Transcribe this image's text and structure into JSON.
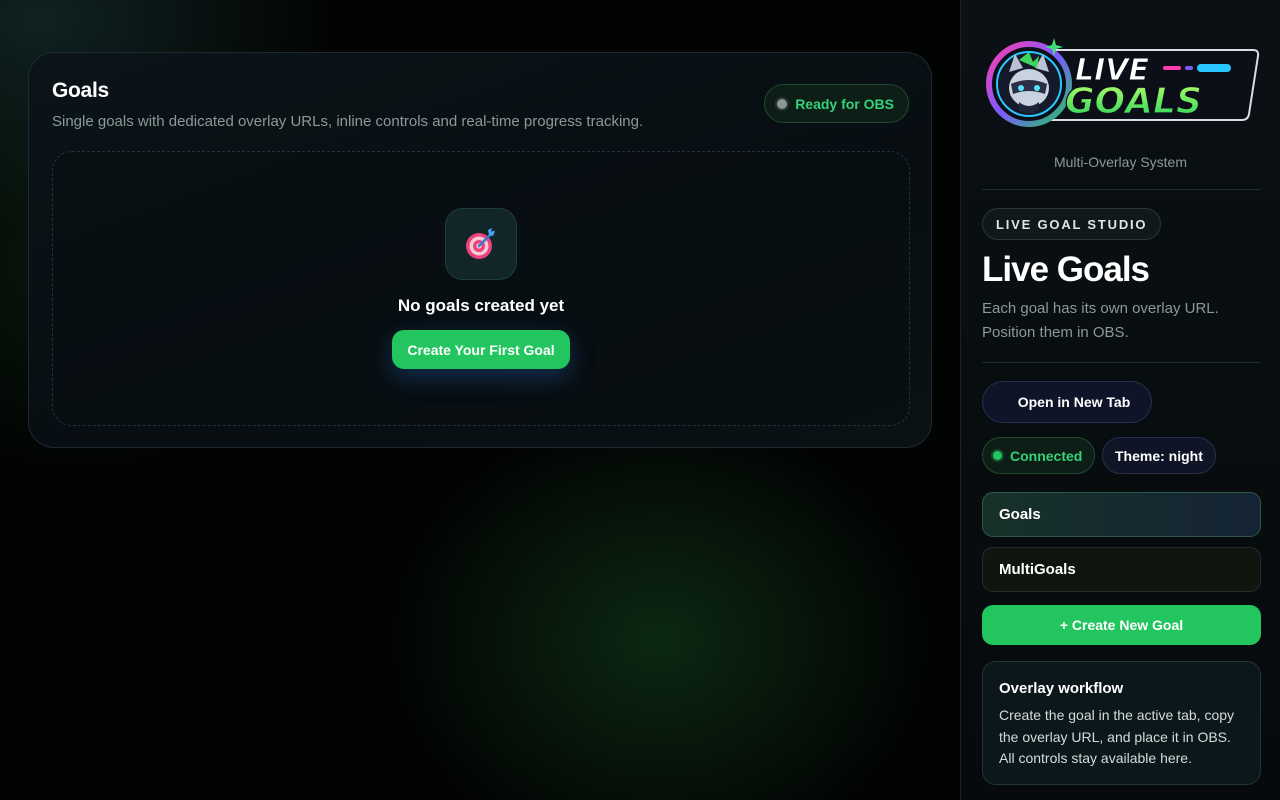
{
  "main": {
    "title": "Goals",
    "subtitle": "Single goals with dedicated overlay URLs, inline controls and real-time progress tracking.",
    "status_badge": "Ready for OBS",
    "empty_state": {
      "icon": "target-dart-icon",
      "title": "No goals created yet",
      "cta_label": "Create Your First Goal"
    }
  },
  "sidebar": {
    "logo": {
      "line1": "LIVE",
      "line2": "GOALS",
      "icon": "raccoon-mascot-icon"
    },
    "tagline": "Multi-Overlay System",
    "studio_pill": "LIVE GOAL STUDIO",
    "title": "Live Goals",
    "description": "Each goal has its own overlay URL. Position them in OBS.",
    "open_tab_label": "Open in New Tab",
    "connection_status": "Connected",
    "theme_label": "Theme: night",
    "tabs": [
      {
        "label": "Goals",
        "active": true
      },
      {
        "label": "MultiGoals",
        "active": false
      }
    ],
    "create_new_label": "+ Create New Goal",
    "workflow": {
      "title": "Overlay workflow",
      "text": "Create the goal in the active tab, copy the overlay URL, and place it in OBS. All controls stay available here."
    }
  },
  "colors": {
    "accent_green": "#22c55e",
    "status_green": "#35d07a",
    "background": "#020403"
  }
}
